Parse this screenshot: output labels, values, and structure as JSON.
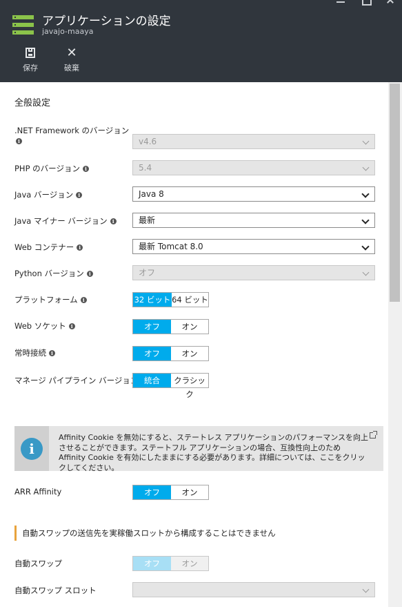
{
  "header": {
    "title": "アプリケーションの設定",
    "subtitle": "javajo-maaya",
    "icon": "app-service-icon",
    "commands": [
      {
        "label": "保存",
        "icon": "save-icon"
      },
      {
        "label": "破棄",
        "icon": "close-icon"
      }
    ]
  },
  "general": {
    "title": "全般設定",
    "netfx": {
      "label": ".NET Framework のバージョン",
      "value": "v4.6"
    },
    "php": {
      "label": "PHP のバージョン",
      "value": "5.4"
    },
    "java": {
      "label": "Java バージョン",
      "value": "Java 8"
    },
    "java_minor": {
      "label": "Java マイナー バージョン",
      "value": "最新"
    },
    "web_container": {
      "label": "Web コンテナー",
      "value": "最新 Tomcat 8.0"
    },
    "python": {
      "label": "Python バージョン",
      "value": "オフ"
    },
    "platform": {
      "label": "プラットフォーム",
      "options": [
        "32 ビット",
        "64 ビット"
      ],
      "selected": "32 ビット"
    },
    "websocket": {
      "label": "Web ソケット",
      "options": [
        "オフ",
        "オン"
      ],
      "selected": "オフ"
    },
    "always_on": {
      "label": "常時接続",
      "options": [
        "オフ",
        "オン"
      ],
      "selected": "オフ"
    },
    "pipeline": {
      "label": "マネージ パイプライン バージョン",
      "options": [
        "統合",
        "クラシック"
      ],
      "selected": "統合"
    }
  },
  "affinity_info": {
    "text": "Affinity Cookie を無効にすると、ステートレス アプリケーションのパフォーマンスを向上させることができます。ステートフル アプリケーションの場合、互換性向上のため Affinity Cookie を有効にしたままにする必要があります。詳細については、ここをクリックしてください。"
  },
  "arr_affinity": {
    "label": "ARR Affinity",
    "options": [
      "オフ",
      "オン"
    ],
    "selected": "オフ"
  },
  "swap_warning": "自動スワップの送信先を実稼働スロットから構成することはできません",
  "auto_swap": {
    "label": "自動スワップ",
    "options": [
      "オフ",
      "オン"
    ],
    "selected": "オフ"
  },
  "auto_swap_slot": {
    "label": "自動スワップ スロット",
    "value": ""
  },
  "colors": {
    "header_bg": "#30363d",
    "accent": "#00abec",
    "info_icon": "#3999c6",
    "warning_bar": "#e8a33c"
  }
}
